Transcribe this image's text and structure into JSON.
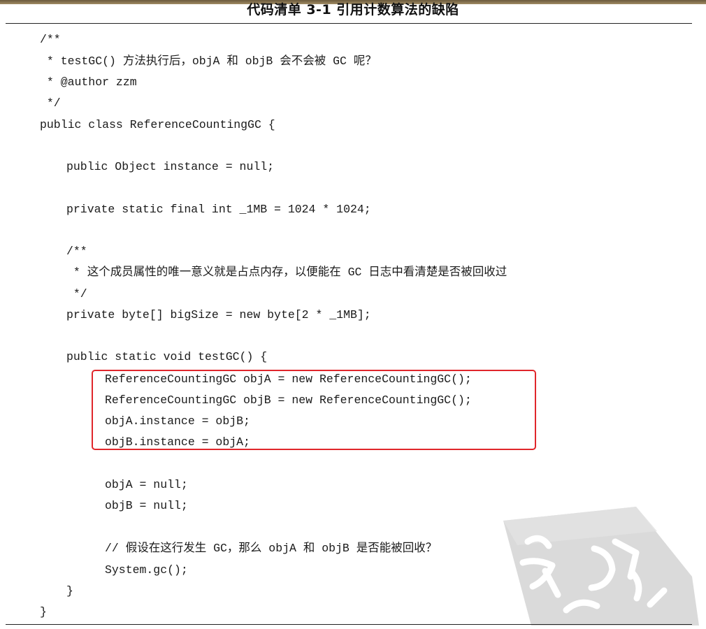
{
  "listing": {
    "title": "代码清单 3-1   引用计数算法的缺陷"
  },
  "code": {
    "lines": [
      "/**",
      " * testGC() 方法执行后，objA 和 objB 会不会被 GC 呢？",
      " * @author zzm",
      " */",
      "public class ReferenceCountingGC {",
      "public Object instance = null;",
      "private static final int _1MB = 1024 * 1024;",
      "/**",
      " * 这个成员属性的唯一意义就是占点内存，以便能在 GC 日志中看清楚是否被回收过",
      " */",
      "private byte[] bigSize = new byte[2 * _1MB];",
      "public static void testGC() {",
      "ReferenceCountingGC objA = new ReferenceCountingGC();",
      "ReferenceCountingGC objB = new ReferenceCountingGC();",
      "objA.instance = objB;",
      "objB.instance = objA;",
      "objA = null;",
      "objB = null;",
      "// 假设在这行发生 GC，那么 objA 和 objB 是否能被回收？",
      "System.gc();",
      "}",
      "}"
    ]
  },
  "annotation": {
    "highlight_color": "#e0262b"
  },
  "watermark": {
    "seal_color": "#c9c9c9"
  }
}
